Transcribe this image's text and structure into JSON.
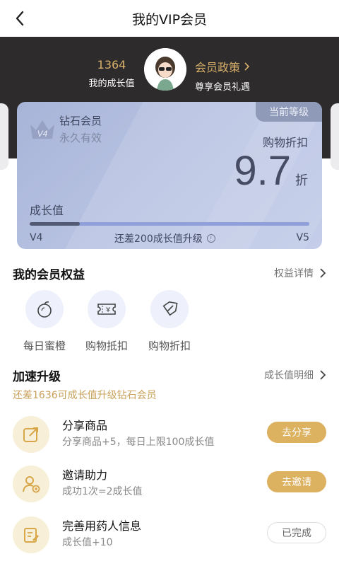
{
  "header": {
    "title": "我的VIP会员"
  },
  "summary": {
    "growth_value": "1364",
    "growth_label": "我的成长值",
    "policy_title": "会员政策",
    "policy_sub": "尊享会员礼遇"
  },
  "card": {
    "current_tag": "当前等级",
    "crown_level": "V4",
    "level_name": "钻石会员",
    "validity": "永久有效",
    "discount_label": "购物折扣",
    "discount_value": "9.7",
    "discount_unit": "折",
    "growth_label": "成长值",
    "progress_fraction": 0.18,
    "level_from": "V4",
    "level_to": "V5",
    "upgrade_need": "还差200成长值升级"
  },
  "benefits": {
    "title": "我的会员权益",
    "link": "权益详情",
    "items": [
      {
        "label": "每日蜜橙",
        "icon": "orange-icon"
      },
      {
        "label": "购物抵扣",
        "icon": "coupon-icon"
      },
      {
        "label": "购物折扣",
        "icon": "discount-tag-icon"
      }
    ]
  },
  "accelerate": {
    "title": "加速升级",
    "link": "成长值明细",
    "subtitle": "还差1636可成长值升级钻石会员",
    "tasks": [
      {
        "title": "分享商品",
        "desc": "分享商品+5，每日上限100成长值",
        "button": "去分享",
        "icon": "share-icon"
      },
      {
        "title": "邀请助力",
        "desc": "成功1次=2成长值",
        "button": "去邀请",
        "icon": "invite-user-icon"
      },
      {
        "title": "完善用药人信息",
        "desc": "成长值+10",
        "button": "已完成",
        "icon": "edit-info-icon"
      }
    ]
  },
  "colors": {
    "accent_gold": "#dcb160",
    "hero_bg": "#2d2b2c",
    "card_blue": "#b7c2e2"
  }
}
